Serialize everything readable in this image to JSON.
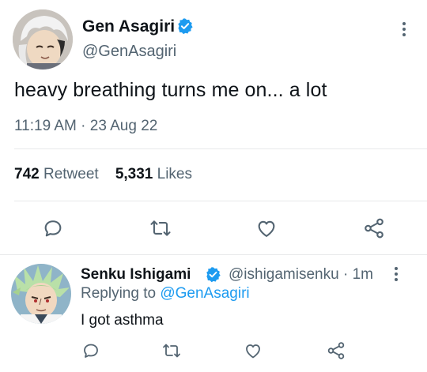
{
  "main_tweet": {
    "name": "Gen Asagiri",
    "handle": "@GenAsagiri",
    "text": "heavy breathing turns me on... a lot",
    "timestamp": "11:19 AM · 23 Aug 22",
    "retweets_count": "742",
    "retweets_label": "Retweet",
    "likes_count": "5,331",
    "likes_label": "Likes"
  },
  "reply": {
    "name": "Senku Ishigami",
    "handle_time": "@ishigamisenku · 1m",
    "replying_prefix": "Replying to",
    "replying_to": "@GenAsagiri",
    "text": "I got asthma"
  },
  "colors": {
    "verified": "#1d9bf0",
    "link": "#1d9bf0",
    "secondary_text": "#536471",
    "divider": "#e7e9ea"
  },
  "icons": [
    "verified-badge-icon",
    "more-icon",
    "reply-icon",
    "retweet-icon",
    "like-icon",
    "share-icon"
  ]
}
